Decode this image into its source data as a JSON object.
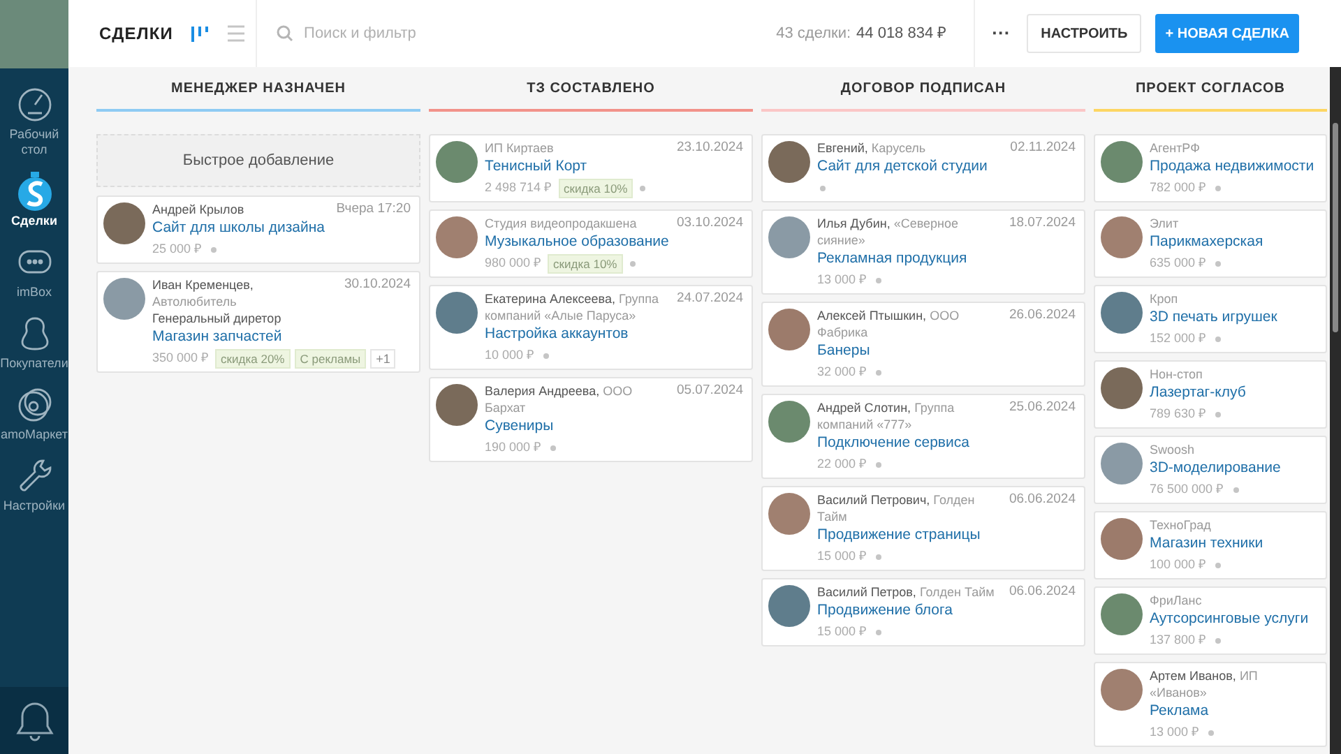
{
  "sidebar": {
    "items": [
      {
        "kind": "gauge",
        "label": "Рабочий стол",
        "selected": false
      },
      {
        "kind": "deals",
        "label": "Сделки",
        "selected": true
      },
      {
        "kind": "chat",
        "label": "imBox",
        "selected": false
      },
      {
        "kind": "person",
        "label": "Покупатели",
        "selected": false
      },
      {
        "kind": "market",
        "label": "amoМаркет",
        "selected": false
      },
      {
        "kind": "wrench",
        "label": "Настройки",
        "selected": false
      }
    ]
  },
  "header": {
    "title": "СДЕЛКИ",
    "search": {
      "placeholder": "Поиск и фильтр"
    },
    "summary_label": "43 сделки:",
    "summary_value": "44 018 834 ₽",
    "more": "···",
    "configure_button": "НАСТРОИТЬ",
    "new_button": "+ НОВАЯ СДЕЛКА"
  },
  "columns": [
    {
      "title": "МЕНЕДЖЕР НАЗНАЧЕН",
      "color": "#8ecbf3",
      "quick_add": "Быстрое добавление",
      "cards": [
        {
          "contact": "Андрей Крылов",
          "date": "Вчера 17:20",
          "title": "Сайт для школы дизайна",
          "price": "25 000 ₽"
        },
        {
          "contact": "Иван Кременцев,",
          "company": "Автолюбитель",
          "role": "Генеральный диретор",
          "date": "30.10.2024",
          "title": "Магазин запчастей",
          "price": "350 000 ₽",
          "tags": [
            "скидка 20%",
            "С рекламы"
          ],
          "more_tags": "+1"
        }
      ]
    },
    {
      "title": "ТЗ СОСТАВЛЕНО",
      "color": "#f2928a",
      "cards": [
        {
          "company": "ИП Киртаев",
          "date": "23.10.2024",
          "title": "Тенисный Корт",
          "price": "2 498 714 ₽",
          "tags": [
            "скидка 10%"
          ]
        },
        {
          "company": "Студия видеопродакшена",
          "date": "03.10.2024",
          "title": "Музыкальное образование",
          "price": "980 000 ₽",
          "tags": [
            "скидка 10%"
          ]
        },
        {
          "contact": "Екатерина Алексеева,",
          "company": "Группа компаний «Алые Паруса»",
          "date": "24.07.2024",
          "title": "Настройка аккаунтов",
          "price": "10 000 ₽"
        },
        {
          "contact": "Валерия Андреева,",
          "company": "ООО Бархат",
          "date": "05.07.2024",
          "title": "Сувениры",
          "price": "190 000 ₽"
        }
      ]
    },
    {
      "title": "ДОГОВОР ПОДПИСАН",
      "color": "#fbc6c6",
      "cards": [
        {
          "contact": "Евгений,",
          "company": "Карусель",
          "date": "02.11.2024",
          "title": "Сайт для детской студии"
        },
        {
          "contact": "Илья Дубин,",
          "company": "«Северное сияние»",
          "date": "18.07.2024",
          "title": "Рекламная продукция",
          "price": "13 000 ₽"
        },
        {
          "contact": "Алексей Птышкин,",
          "company": "ООО Фабрика",
          "date": "26.06.2024",
          "title": "Банеры",
          "price": "32 000 ₽"
        },
        {
          "contact": "Андрей Слотин,",
          "company": "Группа компаний «777»",
          "date": "25.06.2024",
          "title": "Подключение сервиса",
          "price": "22 000 ₽"
        },
        {
          "contact": "Василий Петрович,",
          "company": "Голден Тайм",
          "date": "06.06.2024",
          "title": "Продвижение страницы",
          "price": "15 000 ₽"
        },
        {
          "contact": "Василий Петров,",
          "company": "Голден Тайм",
          "date": "06.06.2024",
          "title": "Продвижение блога",
          "price": "15 000 ₽"
        }
      ]
    },
    {
      "title": "ПРОЕКТ СОГЛАСОВ",
      "color": "#fdd663",
      "cards": [
        {
          "company": "АгентРФ",
          "title": "Продажа недвижимости",
          "price": "782 000 ₽"
        },
        {
          "company": "Элит",
          "title": "Парикмахерская",
          "price": "635 000 ₽"
        },
        {
          "company": "Кроп",
          "title": "3D печать игрушек",
          "price": "152 000 ₽"
        },
        {
          "company": "Нон-стоп",
          "title": "Лазертаг-клуб",
          "price": "789 630 ₽"
        },
        {
          "company": "Swoosh",
          "title": "3D-моделирование",
          "price": "76 500 000 ₽"
        },
        {
          "company": "ТехноГрад",
          "title": "Магазин техники",
          "price": "100 000 ₽"
        },
        {
          "company": "ФриЛанс",
          "title": "Аутсорсинговые услуги",
          "price": "137 800 ₽"
        },
        {
          "contact": "Артем Иванов,",
          "company": "ИП «Иванов»",
          "title": "Реклама",
          "price": "13 000 ₽"
        }
      ]
    }
  ]
}
